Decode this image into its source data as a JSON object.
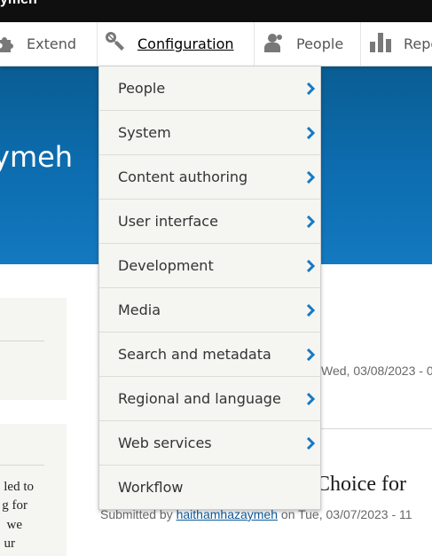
{
  "site": {
    "name": "ymeh"
  },
  "toolbar": {
    "items": [
      {
        "label": "Extend",
        "icon": "puzzle-icon"
      },
      {
        "label": "Configuration",
        "icon": "wrench-icon"
      },
      {
        "label": "People",
        "icon": "people-icon"
      },
      {
        "label": "Repo",
        "icon": "bar-chart-icon"
      }
    ]
  },
  "hero": {
    "title": "ymeh"
  },
  "config_menu": {
    "items": [
      {
        "label": "People"
      },
      {
        "label": "System"
      },
      {
        "label": "Content authoring"
      },
      {
        "label": "User interface"
      },
      {
        "label": "Development"
      },
      {
        "label": "Media"
      },
      {
        "label": "Search and metadata"
      },
      {
        "label": "Regional and language"
      },
      {
        "label": "Web services"
      },
      {
        "label": "Workflow"
      }
    ]
  },
  "sidebar": {
    "text_lines": [
      "led to",
      "g for",
      "we",
      "ur"
    ]
  },
  "main": {
    "date1": "Wed, 03/08/2023 - 0",
    "article_title": "o Choice for",
    "submitted_prefix": "Submitted by ",
    "author": "haithamhazaymeh",
    "submitted_suffix": " on Tue, 03/07/2023 - 11"
  },
  "colors": {
    "accent": "#0b5a9b",
    "hero": "#0c6cae",
    "menu_bg": "#f5f5f2",
    "chevron": "#1579c4"
  }
}
